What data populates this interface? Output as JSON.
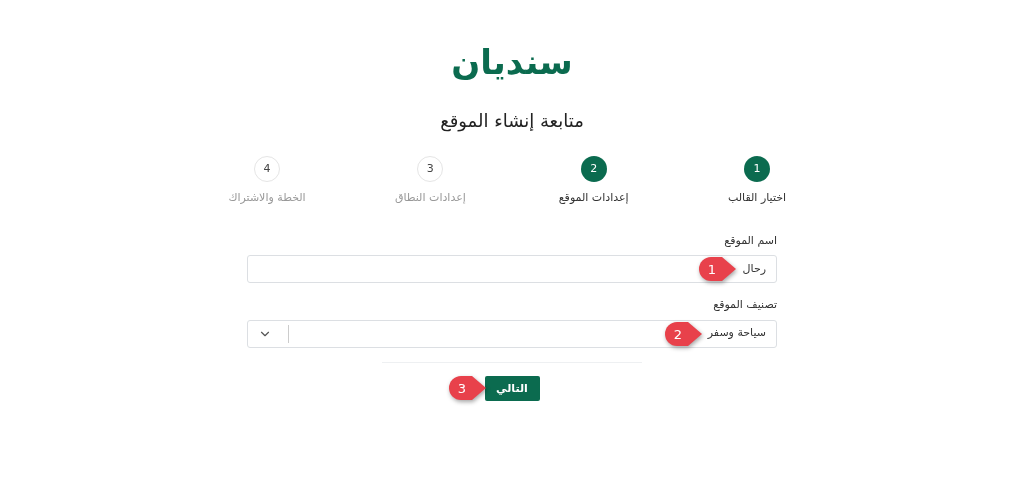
{
  "logo": "سنديان",
  "title": "متابعة إنشاء الموقع",
  "steps": [
    {
      "number": "1",
      "label": "اختيار القالب",
      "active": true
    },
    {
      "number": "2",
      "label": "إعدادات الموقع",
      "active": true
    },
    {
      "number": "3",
      "label": "إعدادات النطاق",
      "active": false
    },
    {
      "number": "4",
      "label": "الخطة والاشتراك",
      "active": false
    }
  ],
  "fields": [
    {
      "kind": "text",
      "label": "اسم الموقع",
      "value": "رحال",
      "callout": "1"
    },
    {
      "kind": "select",
      "label": "تصنيف الموقع",
      "value": "سياحة وسفر",
      "callout": "2"
    }
  ],
  "next_button": {
    "label": "التالي",
    "callout": "3"
  }
}
